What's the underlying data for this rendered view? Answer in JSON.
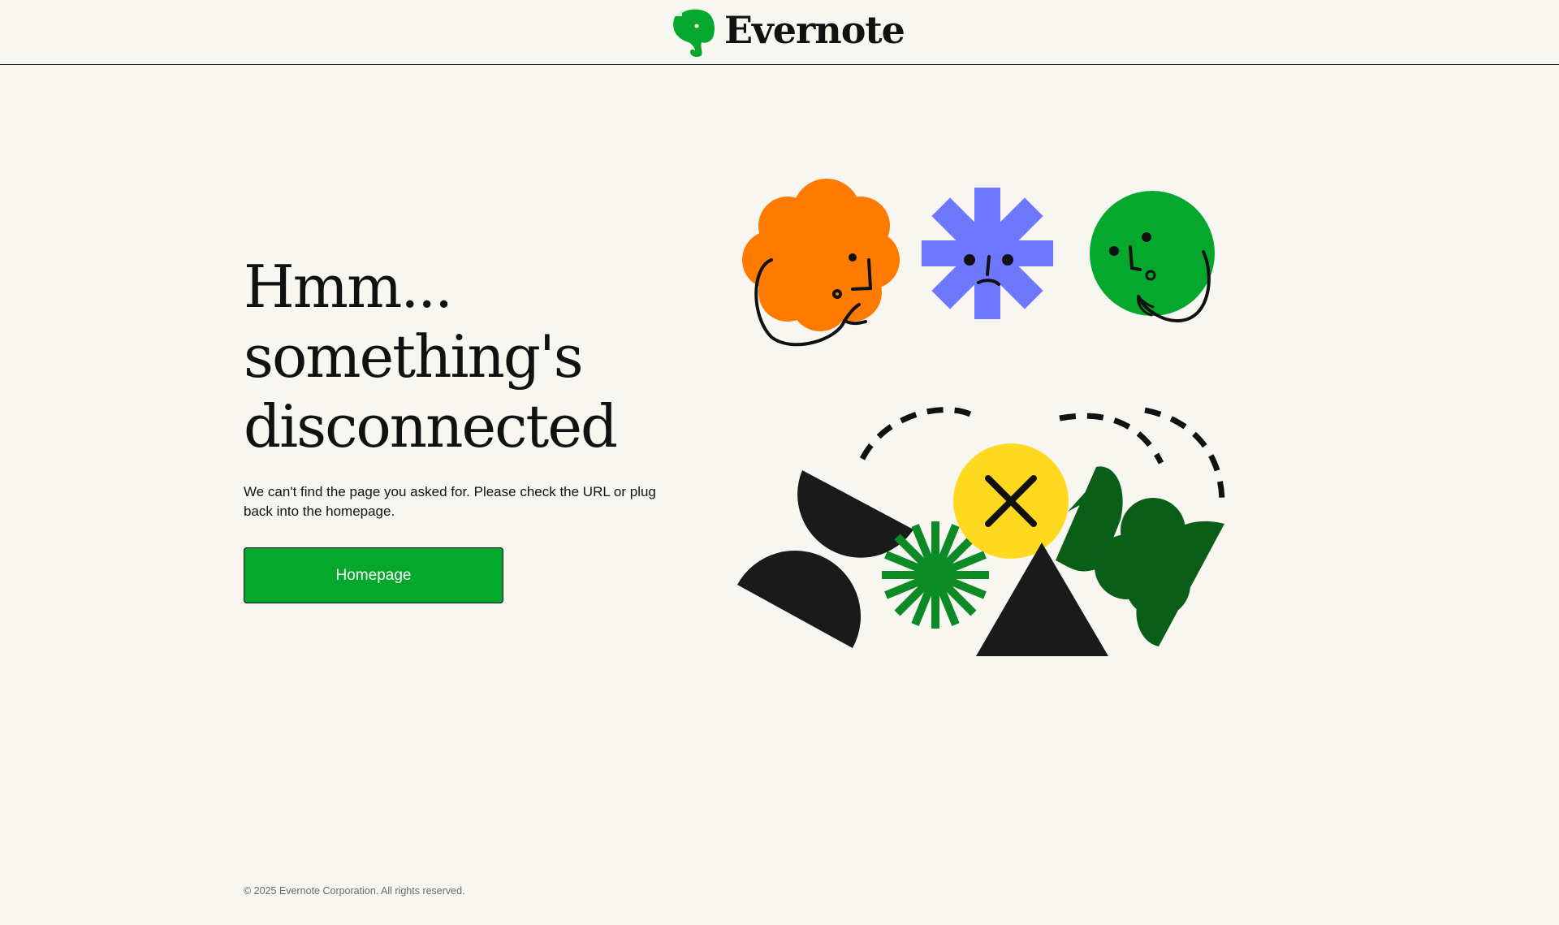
{
  "header": {
    "brand": "Evernote",
    "logo_icon": "elephant-logo-icon",
    "brand_color": "#04a82d"
  },
  "hero": {
    "title_lines": [
      "Hmm...",
      "something's",
      "disconnected"
    ],
    "description": "We can't find the page you asked for. Please check the URL or plug back into the homepage.",
    "button_label": "Homepage",
    "button_color": "#04a82d"
  },
  "illustration": {
    "shapes": [
      "orange-cloud-face",
      "blue-asterisk-face",
      "green-circle-face",
      "yellow-x-circle",
      "black-half-circles",
      "green-starburst",
      "black-triangle",
      "dark-green-blob"
    ],
    "colors": {
      "orange": "#ff7a00",
      "blue": "#6d78ff",
      "green": "#04a82d",
      "dark_green": "#0a5e18",
      "yellow": "#ffd91f",
      "black": "#1a1a1a"
    }
  },
  "footer": {
    "copyright": "© 2025 Evernote Corporation. All rights reserved."
  }
}
